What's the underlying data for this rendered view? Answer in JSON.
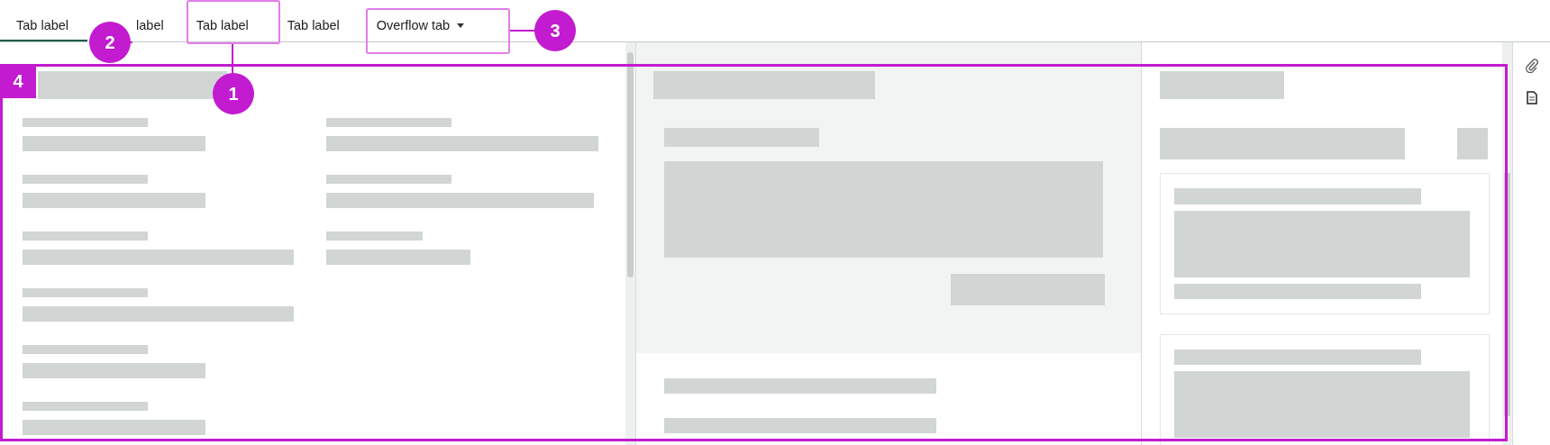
{
  "tabs": [
    {
      "label": "Tab label",
      "selected": true,
      "kind": "tab"
    },
    {
      "label": "label",
      "selected": false,
      "kind": "tab"
    },
    {
      "label": "Tab label",
      "selected": false,
      "kind": "tab"
    },
    {
      "label": "Tab label",
      "selected": false,
      "kind": "tab"
    },
    {
      "label": "Overflow tab",
      "selected": false,
      "kind": "overflow"
    }
  ],
  "callouts": [
    {
      "label": "1"
    },
    {
      "label": "2"
    },
    {
      "label": "3"
    },
    {
      "label": "4"
    }
  ]
}
